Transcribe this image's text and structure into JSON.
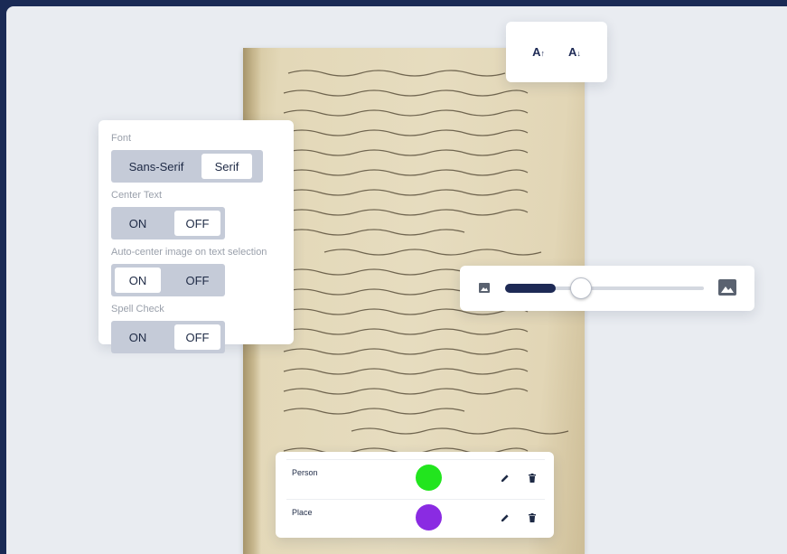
{
  "font_settings": {
    "font_label": "Font",
    "font_options": [
      "Sans-Serif",
      "Serif"
    ],
    "font_selected": "Serif",
    "center_text_label": "Center Text",
    "auto_center_label": "Auto-center image on text selection",
    "spell_check_label": "Spell Check",
    "on_label": "ON",
    "off_label": "OFF",
    "center_text_selected": "OFF",
    "auto_center_selected": "ON",
    "spell_check_selected": "OFF"
  },
  "font_size": {
    "increase_label": "A",
    "increase_arrow": "↑",
    "decrease_label": "A",
    "decrease_arrow": "↓"
  },
  "zoom": {
    "level": 0.2,
    "min_icon": "image-small-icon",
    "max_icon": "image-large-icon"
  },
  "entities": [
    {
      "name": "Person",
      "color": "#22e51e"
    },
    {
      "name": "Place",
      "color": "#8a2be2"
    }
  ],
  "colors": {
    "accent": "#1e2a55",
    "toggle_track": "#c5cbd8"
  }
}
